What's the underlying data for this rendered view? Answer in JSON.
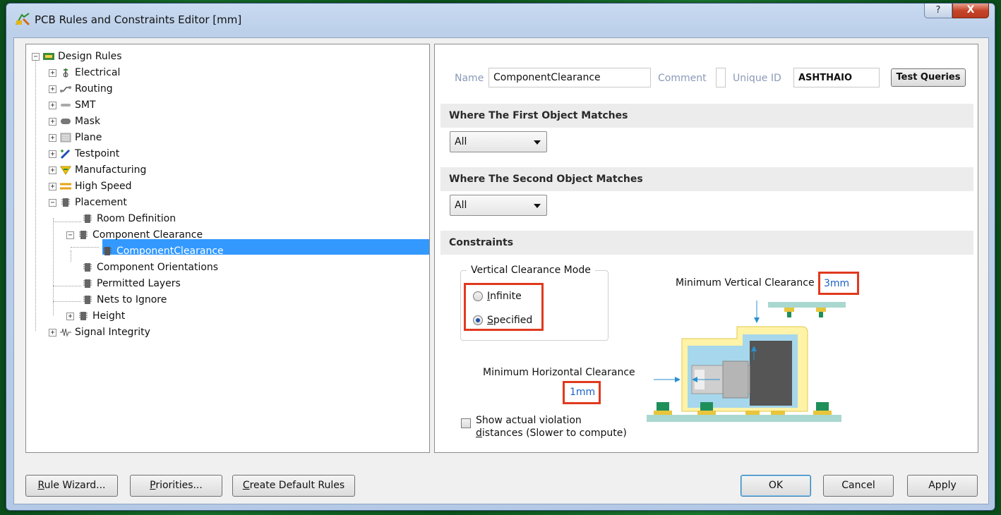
{
  "window": {
    "title": "PCB Rules and Constraints Editor [mm]",
    "help_label": "?",
    "close_label": "X"
  },
  "tree": {
    "root": "Design Rules",
    "items": [
      {
        "label": "Electrical"
      },
      {
        "label": "Routing"
      },
      {
        "label": "SMT"
      },
      {
        "label": "Mask"
      },
      {
        "label": "Plane"
      },
      {
        "label": "Testpoint"
      },
      {
        "label": "Manufacturing"
      },
      {
        "label": "High Speed"
      },
      {
        "label": "Placement"
      },
      {
        "label": "Room Definition"
      },
      {
        "label": "Component Clearance"
      },
      {
        "label": "ComponentClearance"
      },
      {
        "label": "Component Orientations"
      },
      {
        "label": "Permitted Layers"
      },
      {
        "label": "Nets to Ignore"
      },
      {
        "label": "Height"
      },
      {
        "label": "Signal Integrity"
      }
    ]
  },
  "rule": {
    "name_label": "Name",
    "name_value": "ComponentClearance",
    "comment_label": "Comment",
    "comment_value": "",
    "uid_label": "Unique ID",
    "uid_value": "ASHTHAIO",
    "test_queries": "Test Queries"
  },
  "sections": {
    "first": "Where The First Object Matches",
    "second": "Where The Second Object Matches",
    "constraints": "Constraints"
  },
  "first_match": {
    "selected": "All"
  },
  "second_match": {
    "selected": "All"
  },
  "constraints": {
    "vertical_mode_title": "Vertical Clearance Mode",
    "infinite_pre": "",
    "infinite_ul": "I",
    "infinite_post": "nfinite",
    "specified_pre": "",
    "specified_ul": "S",
    "specified_post": "pecified",
    "selected_mode": "Specified",
    "min_vertical_label": "Minimum Vertical Clearance",
    "min_vertical_value": "3mm",
    "min_horizontal_label": "Minimum Horizontal Clearance",
    "min_horizontal_value": "1mm",
    "show_violation_line1": "Show actual violation",
    "show_violation_line2_ul": "d",
    "show_violation_line2_rest": "istances (Slower to compute)",
    "show_violation_checked": false
  },
  "buttons": {
    "rule_wizard_ul": "R",
    "rule_wizard_rest": "ule Wizard...",
    "priorities_ul": "P",
    "priorities_rest": "riorities...",
    "create_default_ul": "C",
    "create_default_rest": "reate Default Rules",
    "ok": "OK",
    "cancel": "Cancel",
    "apply": "Apply"
  },
  "colors": {
    "selection": "#3399ff",
    "highlight_box": "#e03a1e",
    "value_link": "#1c62c4"
  }
}
